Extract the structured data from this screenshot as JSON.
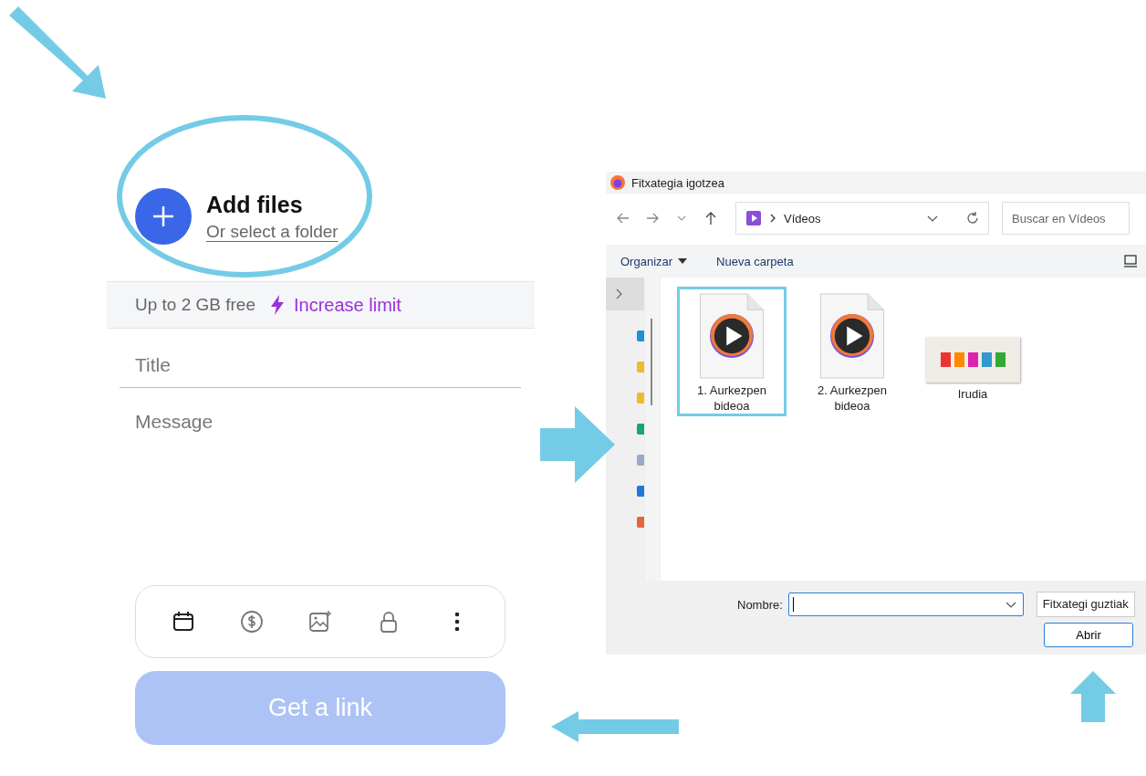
{
  "upload_form": {
    "add_files": {
      "title": "Add files",
      "link": "Or select a folder"
    },
    "limit_bar": {
      "text": "Up to 2 GB free",
      "link": "Increase limit"
    },
    "title_field": {
      "placeholder": "Title"
    },
    "message_field": {
      "placeholder": "Message"
    },
    "get_link_button": {
      "label": "Get a link",
      "disabled": true
    }
  },
  "file_dialog": {
    "title": "Fitxategia igotzea",
    "path": "Vídeos",
    "search": {
      "placeholder": "Buscar en Vídeos"
    },
    "commands": [
      "Organizar",
      "Nueva carpeta"
    ],
    "files": [
      {
        "kind": "video",
        "name": "1. Aurkezpen bideoa",
        "selected": true
      },
      {
        "kind": "video",
        "name": "2. Aurkezpen bideoa",
        "selected": false
      },
      {
        "kind": "image",
        "name": "Irudia",
        "selected": false
      }
    ],
    "filename_label": "Nombre:",
    "file_type": "Fitxategi guztiak",
    "open_button": "Abrir"
  }
}
